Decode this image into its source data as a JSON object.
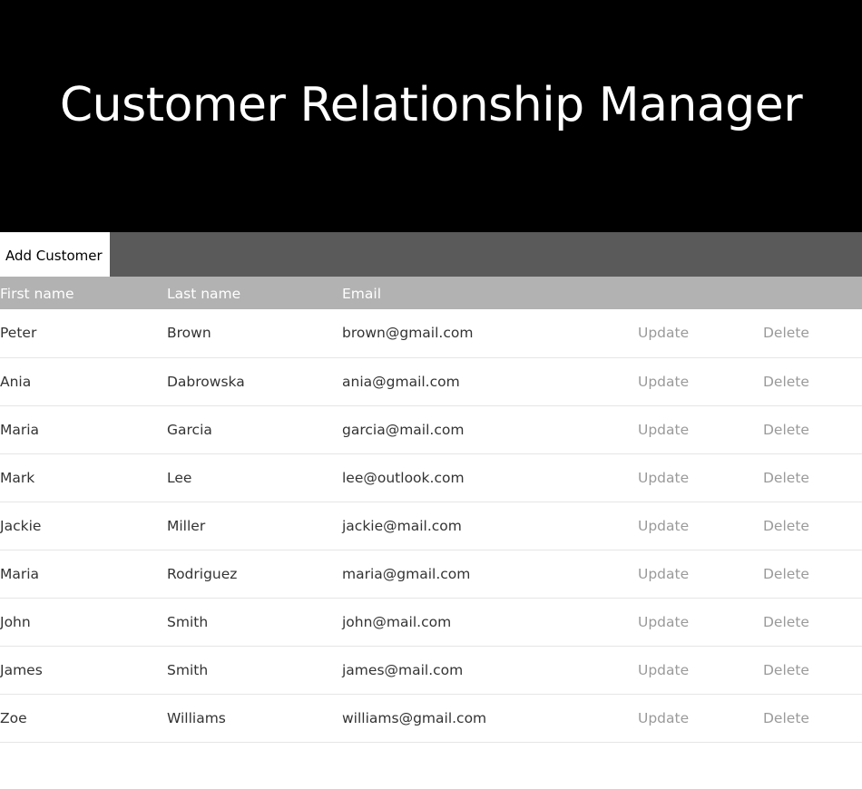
{
  "header": {
    "title": "Customer Relationship Manager"
  },
  "toolbar": {
    "add_label": "Add Customer"
  },
  "table": {
    "columns": [
      "First name",
      "Last name",
      "Email"
    ],
    "rows": [
      {
        "first": "Peter",
        "last": "Brown",
        "email": "brown@gmail.com",
        "update": "Update",
        "delete": "Delete"
      },
      {
        "first": "Ania",
        "last": "Dabrowska",
        "email": "ania@gmail.com",
        "update": "Update",
        "delete": "Delete"
      },
      {
        "first": "Maria",
        "last": "Garcia",
        "email": "garcia@mail.com",
        "update": "Update",
        "delete": "Delete"
      },
      {
        "first": "Mark",
        "last": "Lee",
        "email": "lee@outlook.com",
        "update": "Update",
        "delete": "Delete"
      },
      {
        "first": "Jackie",
        "last": "Miller",
        "email": "jackie@mail.com",
        "update": "Update",
        "delete": "Delete"
      },
      {
        "first": "Maria",
        "last": "Rodriguez",
        "email": "maria@gmail.com",
        "update": "Update",
        "delete": "Delete"
      },
      {
        "first": "John",
        "last": "Smith",
        "email": "john@mail.com",
        "update": "Update",
        "delete": "Delete"
      },
      {
        "first": "James",
        "last": "Smith",
        "email": "james@mail.com",
        "update": "Update",
        "delete": "Delete"
      },
      {
        "first": "Zoe",
        "last": "Williams",
        "email": "williams@gmail.com",
        "update": "Update",
        "delete": "Delete"
      }
    ]
  },
  "colors": {
    "header_bg": "#000000",
    "toolbar_bg": "#5a5a5a",
    "table_header_bg": "#b2b2b2",
    "action_text": "#9a9a9a"
  }
}
